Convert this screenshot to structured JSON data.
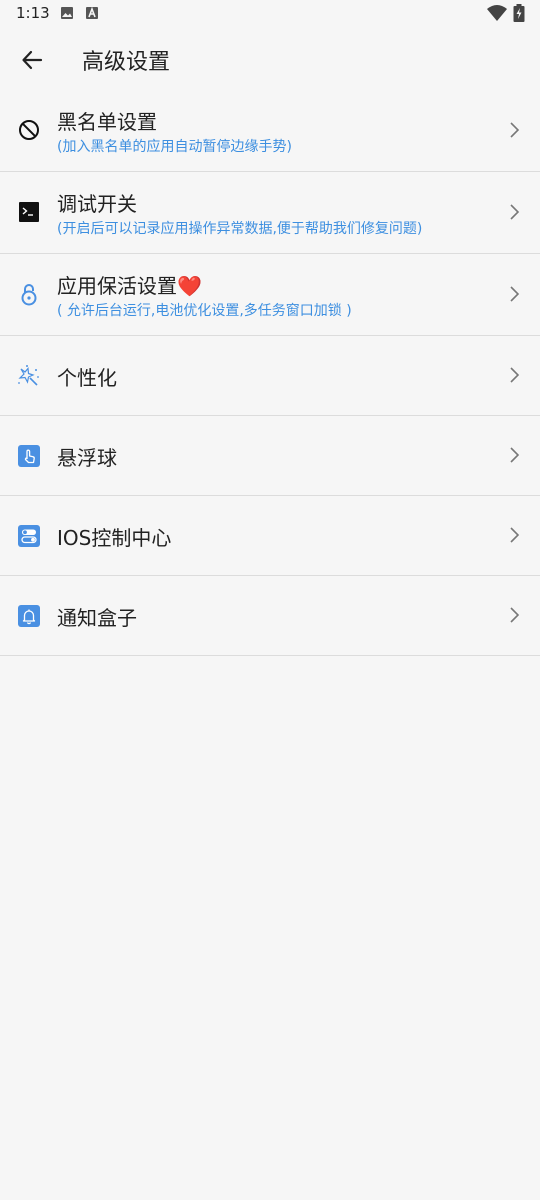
{
  "status_bar": {
    "time": "1:13",
    "icons": [
      "image-icon",
      "text-a-icon",
      "wifi-icon",
      "battery-charging-icon"
    ]
  },
  "app_bar": {
    "back_icon": "arrow-left-icon",
    "title": "高级设置"
  },
  "settings": [
    {
      "icon": "block-icon",
      "title": "黑名单设置",
      "subtitle": "(加入黑名单的应用自动暂停边缘手势)"
    },
    {
      "icon": "terminal-icon",
      "title": "调试开关",
      "subtitle": "(开启后可以记录应用操作异常数据,便于帮助我们修复问题)"
    },
    {
      "icon": "lock-icon",
      "title": "应用保活设置",
      "title_emoji": "❤️",
      "subtitle": "( 允许后台运行,电池优化设置,多任务窗口加锁 )"
    },
    {
      "icon": "magic-wand-icon",
      "title": "个性化"
    },
    {
      "icon": "touch-icon",
      "title": "悬浮球"
    },
    {
      "icon": "toggle-panel-icon",
      "title": "IOS控制中心"
    },
    {
      "icon": "bell-icon",
      "title": "通知盒子"
    }
  ],
  "colors": {
    "background": "#f6f6f6",
    "accent_blue": "#3d8fe0",
    "icon_blue": "#4a90e2",
    "divider": "#dcdcdc",
    "text_primary": "#222222",
    "chevron": "#777777"
  }
}
